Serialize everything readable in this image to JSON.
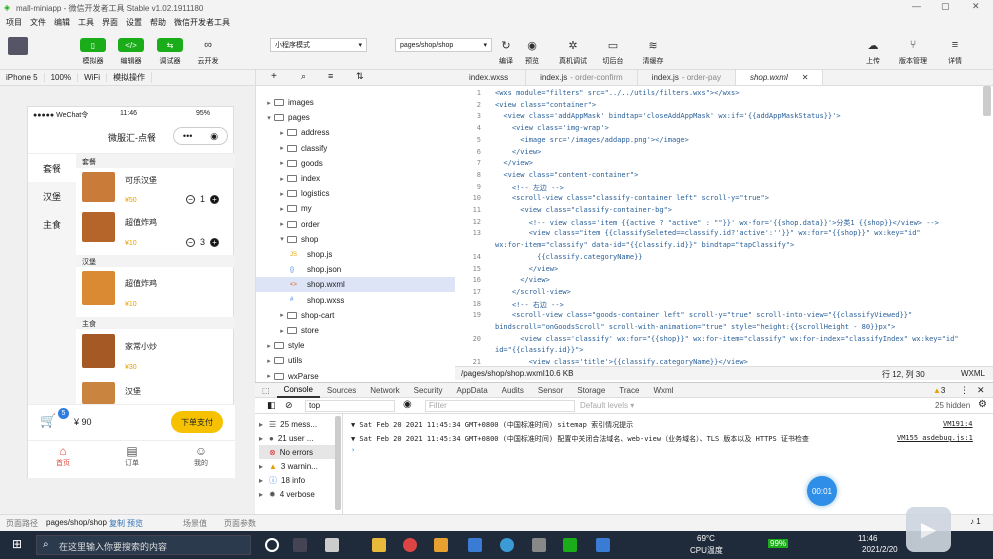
{
  "window": {
    "title": "mall-miniapp - 微信开发者工具 Stable v1.02.1911180"
  },
  "menu": [
    "项目",
    "文件",
    "编辑",
    "工具",
    "界面",
    "设置",
    "帮助",
    "微信开发者工具"
  ],
  "toolbar": {
    "simulator": "模拟器",
    "editor": "编辑器",
    "debugger": "调试器",
    "cloud": "云开发",
    "mode": "小程序模式",
    "page": "pages/shop/shop",
    "compile": "编译",
    "preview": "预览",
    "realdebug": "真机调试",
    "background": "切后台",
    "clearcache": "清缓存",
    "upload": "上传",
    "version": "版本管理",
    "details": "详情"
  },
  "simbar": {
    "device": "iPhone 5",
    "zoom": "100%",
    "network": "WiFi",
    "action": "模拟操作"
  },
  "phone": {
    "status": {
      "carrier": "●●●●● WeChat令",
      "time": "11:46",
      "battery": "95%"
    },
    "title": "微服汇-点餐",
    "nav": [
      "套餐",
      "汉堡",
      "主食"
    ],
    "sections": [
      {
        "name": "套餐",
        "items": [
          {
            "name": "可乐汉堡",
            "price": "¥50",
            "qty": "1"
          },
          {
            "name": "超值炸鸡",
            "price": "¥10",
            "qty": "3"
          }
        ]
      },
      {
        "name": "汉堡",
        "items": [
          {
            "name": "超值炸鸡",
            "price": "¥10"
          }
        ]
      },
      {
        "name": "主食",
        "items": [
          {
            "name": "家常小炒",
            "price": "¥30"
          },
          {
            "name": "汉堡"
          }
        ]
      }
    ],
    "cart": {
      "badge": "5",
      "total": "¥ 90",
      "submit": "下单支付"
    },
    "tabbar": [
      "首页",
      "订单",
      "我的"
    ]
  },
  "filetree": [
    {
      "name": "images",
      "level": 0,
      "type": "folder"
    },
    {
      "name": "pages",
      "level": 0,
      "type": "folder",
      "open": true
    },
    {
      "name": "address",
      "level": 1,
      "type": "folder"
    },
    {
      "name": "classify",
      "level": 1,
      "type": "folder"
    },
    {
      "name": "goods",
      "level": 1,
      "type": "folder"
    },
    {
      "name": "index",
      "level": 1,
      "type": "folder"
    },
    {
      "name": "logistics",
      "level": 1,
      "type": "folder"
    },
    {
      "name": "my",
      "level": 1,
      "type": "folder"
    },
    {
      "name": "order",
      "level": 1,
      "type": "folder"
    },
    {
      "name": "shop",
      "level": 1,
      "type": "folder",
      "open": true
    },
    {
      "name": "shop.js",
      "level": 2,
      "type": "js"
    },
    {
      "name": "shop.json",
      "level": 2,
      "type": "json"
    },
    {
      "name": "shop.wxml",
      "level": 2,
      "type": "wxml",
      "selected": true
    },
    {
      "name": "shop.wxss",
      "level": 2,
      "type": "wxss"
    },
    {
      "name": "shop-cart",
      "level": 1,
      "type": "folder"
    },
    {
      "name": "store",
      "level": 1,
      "type": "folder"
    },
    {
      "name": "style",
      "level": 0,
      "type": "folder"
    },
    {
      "name": "utils",
      "level": 0,
      "type": "folder"
    },
    {
      "name": "wxParse",
      "level": 0,
      "type": "folder"
    }
  ],
  "tabs": [
    {
      "name": "index.wxss",
      "hint": ""
    },
    {
      "name": "index.js",
      "hint": "- order-confirm"
    },
    {
      "name": "index.js",
      "hint": "- order-pay"
    },
    {
      "name": "shop.wxml",
      "hint": "",
      "active": true
    }
  ],
  "code": [
    {
      "n": "1",
      "t": "<wxs module=\"filters\" src=\"../../utils/filters.wxs\"></wxs>"
    },
    {
      "n": "2",
      "t": "<view class=\"container\">"
    },
    {
      "n": "3",
      "t": "  <view class='addAppMask' bindtap='closeAddAppMask' wx:if='{{addAppMaskStatus}}'>"
    },
    {
      "n": "4",
      "t": "    <view class='img-wrap'>"
    },
    {
      "n": "5",
      "t": "      <image src='/images/addapp.png'></image>"
    },
    {
      "n": "6",
      "t": "    </view>"
    },
    {
      "n": "7",
      "t": "  </view>"
    },
    {
      "n": "8",
      "t": "  <view class=\"content-container\">"
    },
    {
      "n": "9",
      "t": "    <!-- 左边 -->"
    },
    {
      "n": "10",
      "t": "    <scroll-view class=\"classify-container left\" scroll-y=\"true\">"
    },
    {
      "n": "11",
      "t": "      <view class=\"classify-container-bg\">"
    },
    {
      "n": "12",
      "t": "        <!-- view class='item {{active ? \"active\" : \"\"}}' wx-for='{{shop.data}}'>分类1 {{shop}}</view> -->"
    },
    {
      "n": "13",
      "t": "        <view class=\"item {{classifySeleted==classify.id?'active':''}}\" wx:for=\"{{shop}}\" wx:key=\"id\""
    },
    {
      "n": "",
      "t": "wx:for-item=\"classify\" data-id=\"{{classify.id}}\" bindtap=\"tapClassify\">"
    },
    {
      "n": "14",
      "t": "          {{classify.categoryName}}"
    },
    {
      "n": "15",
      "t": "        </view>"
    },
    {
      "n": "16",
      "t": "      </view>"
    },
    {
      "n": "17",
      "t": "    </scroll-view>"
    },
    {
      "n": "18",
      "t": "    <!-- 右边 -->"
    },
    {
      "n": "19",
      "t": "    <scroll-view class=\"goods-container left\" scroll-y=\"true\" scroll-into-view=\"{{classifyViewed}}\""
    },
    {
      "n": "",
      "t": "bindscroll=\"onGoodsScroll\" scroll-with-animation=\"true\" style=\"height:{{scrollHeight - 80}}px\">"
    },
    {
      "n": "20",
      "t": "      <view class='classify' wx:for=\"{{shop}}\" wx:for-item=\"classify\" wx:for-index=\"classifyIndex\" wx:key=\"id\""
    },
    {
      "n": "",
      "t": "id=\"{{classify.id}}\">"
    },
    {
      "n": "21",
      "t": "        <view class='title'>{{classify.categoryName}}</view>"
    }
  ],
  "editorstatus": {
    "path": "/pages/shop/shop.wxml",
    "size": "10.6 KB",
    "pos": "行 12, 列 30",
    "lang": "WXML"
  },
  "consoletabs": [
    "Console",
    "Sources",
    "Network",
    "Security",
    "AppData",
    "Audits",
    "Sensor",
    "Storage",
    "Trace",
    "Wxml"
  ],
  "consolebar": {
    "context": "top",
    "filter": "Filter",
    "levels": "Default levels ▾",
    "hidden": "25 hidden",
    "warn": "3"
  },
  "consoleside": [
    {
      "label": "25 mess...",
      "icon": "list"
    },
    {
      "label": "21 user ...",
      "icon": "user"
    },
    {
      "label": "No errors",
      "icon": "error"
    },
    {
      "label": "3 warnin...",
      "icon": "warn"
    },
    {
      "label": "18 info",
      "icon": "info"
    },
    {
      "label": "4 verbose",
      "icon": "verbose"
    }
  ],
  "logs": [
    {
      "text": "▼ Sat Feb 20 2021 11:45:34 GMT+0800 (中国标准时间) sitemap 索引情况提示",
      "src": "VM191:4"
    },
    {
      "text": "▼ Sat Feb 20 2021 11:45:34 GMT+0800 (中国标准时间) 配置中关闭合法域名、web-view（业务域名）、TLS 版本以及 HTTPS 证书检查",
      "src": "VM155 asdebug.js:1"
    }
  ],
  "recorder": "00:01",
  "statusbar": {
    "pathlabel": "页面路径",
    "path": "pages/shop/shop",
    "copy": "复制",
    "preview": "预览",
    "scene": "场景值",
    "params": "页面参数",
    "notif": "1"
  },
  "taskbar": {
    "search": "在这里输入你要搜索的内容",
    "temp": "69°C",
    "cpu": "CPU温度",
    "battery": "99%",
    "time": "11:46",
    "date": "2021/2/20"
  }
}
